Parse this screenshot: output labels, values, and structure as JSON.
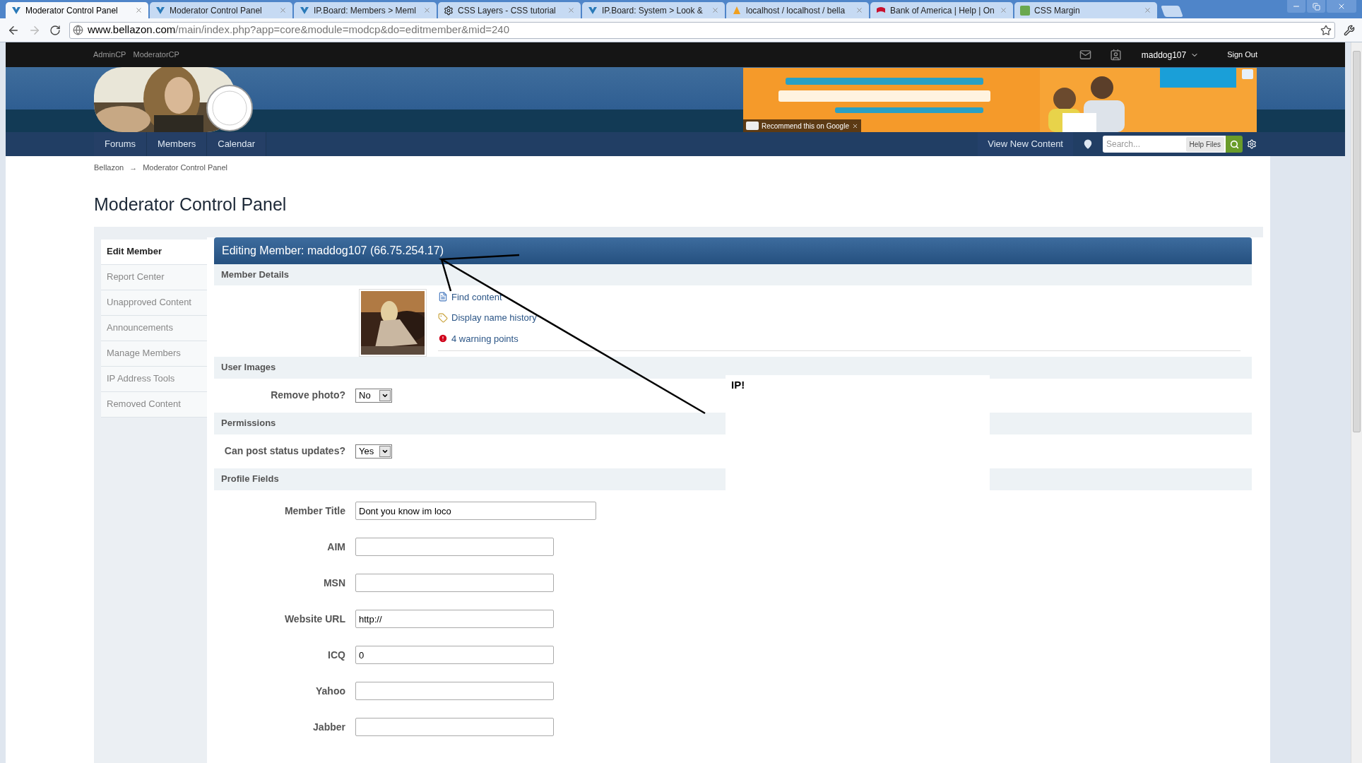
{
  "browser": {
    "tabs": [
      {
        "label": "Moderator Control Panel",
        "kind": "board",
        "selected": true
      },
      {
        "label": "Moderator Control Panel",
        "kind": "board",
        "selected": false
      },
      {
        "label": "IP.Board: Members > Meml",
        "kind": "board",
        "selected": false
      },
      {
        "label": "CSS Layers - CSS tutorial",
        "kind": "gear",
        "selected": false
      },
      {
        "label": "IP.Board: System > Look &",
        "kind": "board",
        "selected": false
      },
      {
        "label": "localhost / localhost / bella",
        "kind": "sail",
        "selected": false
      },
      {
        "label": "Bank of America | Help | On",
        "kind": "flag",
        "selected": false
      },
      {
        "label": "CSS Margin",
        "kind": "w3",
        "selected": false
      }
    ],
    "url_host": "www.bellazon.com",
    "url_path": "/main/index.php?app=core&module=modcp&do=editmember&mid=240"
  },
  "top_bar": {
    "links": [
      "AdminCP",
      "ModeratorCP"
    ],
    "user": "maddog107",
    "sign_out": "Sign Out"
  },
  "ad": {
    "recommend": "Recommend this on Google"
  },
  "nav": {
    "items": [
      "Forums",
      "Members",
      "Calendar"
    ],
    "view_new": "View New Content",
    "search_placeholder": "Search...",
    "help_files": "Help Files"
  },
  "breadcrumb": {
    "items": [
      "Bellazon",
      "Moderator Control Panel"
    ],
    "separator": "→"
  },
  "page_title": "Moderator Control Panel",
  "sidebar": [
    {
      "label": "Edit Member",
      "selected": true
    },
    {
      "label": "Report Center",
      "selected": false
    },
    {
      "label": "Unapproved Content",
      "selected": false
    },
    {
      "label": "Announcements",
      "selected": false
    },
    {
      "label": "Manage Members",
      "selected": false
    },
    {
      "label": "IP Address Tools",
      "selected": false
    },
    {
      "label": "Removed Content",
      "selected": false
    }
  ],
  "panel_title": "Editing Member: maddog107 (66.75.254.17)",
  "member_details": {
    "title": "Member Details",
    "links": [
      {
        "kind": "document",
        "label": "Find content"
      },
      {
        "kind": "tag",
        "label": "Display name history"
      },
      {
        "kind": "warning",
        "label": "4 warning points"
      }
    ]
  },
  "sections": [
    {
      "title": "User Images",
      "fields": [
        {
          "kind": "select",
          "label": "Remove photo?",
          "value": "No"
        }
      ]
    },
    {
      "title": "Permissions",
      "fields": [
        {
          "kind": "select",
          "label": "Can post status updates?",
          "value": "Yes"
        }
      ]
    },
    {
      "title": "Profile Fields",
      "fields": [
        {
          "kind": "longtext",
          "label": "Member Title",
          "value": "Dont you know im loco"
        },
        {
          "kind": "text",
          "label": "AIM"
        },
        {
          "kind": "text",
          "label": "MSN"
        },
        {
          "kind": "text",
          "label": "Website URL",
          "value": "http://"
        },
        {
          "kind": "text",
          "label": "ICQ",
          "value": "0"
        },
        {
          "kind": "text",
          "label": "Yahoo"
        },
        {
          "kind": "text",
          "label": "Jabber"
        }
      ]
    }
  ],
  "annotation": {
    "note": "IP!"
  }
}
